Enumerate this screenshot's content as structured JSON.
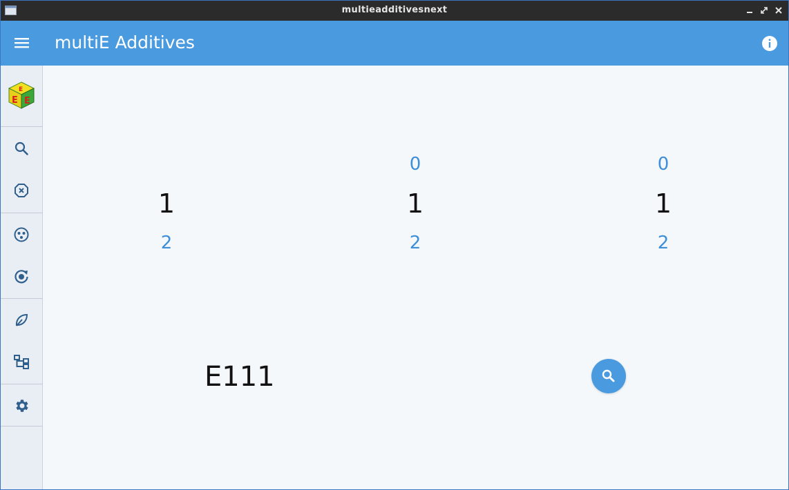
{
  "window": {
    "title": "multieadditivesnext",
    "controls": [
      "minimize",
      "maximize",
      "close"
    ]
  },
  "appbar": {
    "title": "multiE Additives",
    "menu_icon": "hamburger-menu-icon",
    "info_icon": "info-icon"
  },
  "sidebar": {
    "logo": "multie-cube-logo",
    "items": [
      {
        "name": "search",
        "icon": "search-icon"
      },
      {
        "name": "clear",
        "icon": "close-circle-icon"
      },
      {
        "name": "groups",
        "icon": "dots-circle-icon"
      },
      {
        "name": "rotate",
        "icon": "rotate-icon"
      },
      {
        "name": "vegan",
        "icon": "leaf-icon"
      },
      {
        "name": "categories",
        "icon": "hierarchy-icon"
      },
      {
        "name": "settings",
        "icon": "gear-icon"
      }
    ]
  },
  "picker": {
    "columns": [
      {
        "above": "",
        "selected": "1",
        "below": "2"
      },
      {
        "above": "0",
        "selected": "1",
        "below": "2"
      },
      {
        "above": "0",
        "selected": "1",
        "below": "2"
      }
    ]
  },
  "result": {
    "code": "E111",
    "search_icon": "search-icon"
  },
  "colors": {
    "accent": "#4a9ae0",
    "picker_secondary": "#3c8fd8",
    "sidebar_icons": "#2f5f8c"
  }
}
